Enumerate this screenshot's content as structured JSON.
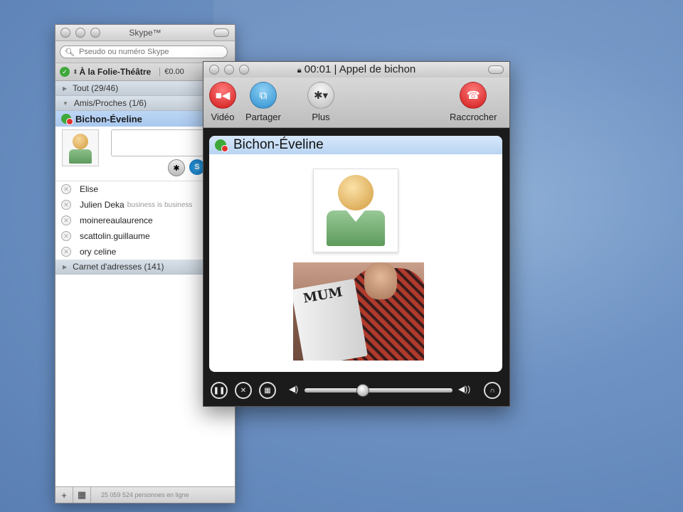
{
  "main_window": {
    "title": "Skype™",
    "search": {
      "placeholder": "Pseudo ou numéro Skype"
    },
    "status": {
      "name": "À la Folie-Théâtre",
      "credit": "€0.00"
    },
    "groups": [
      {
        "label": "Tout (29/46)",
        "expanded": false
      },
      {
        "label": "Amis/Proches (1/6)",
        "expanded": true
      },
      {
        "label": "Carnet d'adresses (141)",
        "expanded": false
      }
    ],
    "selected_contact": "Bichon-Éveline",
    "contacts": [
      {
        "name": "Elise",
        "mood": ""
      },
      {
        "name": "Julien Deka",
        "mood": "business is business"
      },
      {
        "name": "moinereaulaurence",
        "mood": ""
      },
      {
        "name": "scattolin.guillaume",
        "mood": ""
      },
      {
        "name": "ory celine",
        "mood": ""
      }
    ],
    "bottom": {
      "add": "+",
      "dialpad": "▦",
      "online_count": "25 059 524 personnes en ligne"
    }
  },
  "call_window": {
    "title": "00:01 | Appel de bichon",
    "toolbar": {
      "video": "Vidéo",
      "share": "Partager",
      "more": "Plus",
      "hangup": "Raccrocher"
    },
    "contact_name": "Bichon-Éveline",
    "video_overlay_text": "MUM",
    "volume_level": 0.39
  },
  "colors": {
    "accent_blue": "#2c8fcf",
    "hangup_red": "#d01818",
    "online_green": "#3fa83a"
  }
}
